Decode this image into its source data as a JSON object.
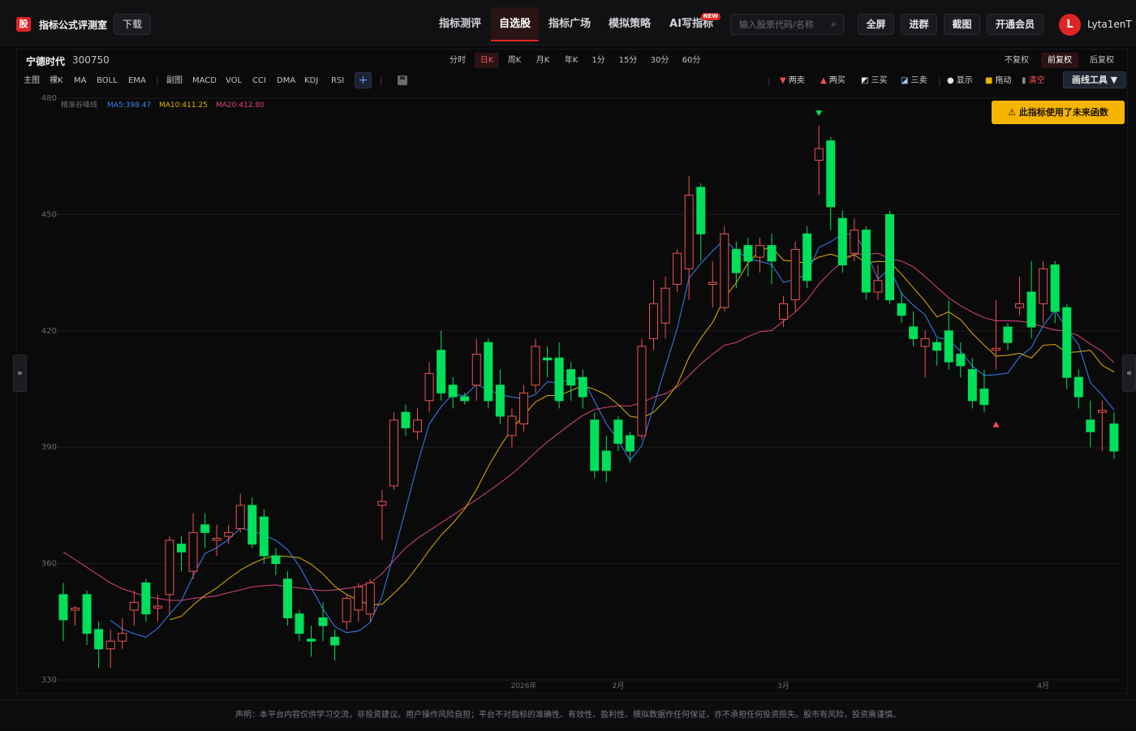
{
  "header": {
    "logo_glyph": "股",
    "app_title": "指标公式评测室",
    "download_label": "下载",
    "nav": [
      {
        "label": "指标测评",
        "active": false,
        "badge": ""
      },
      {
        "label": "自选股",
        "active": true,
        "badge": ""
      },
      {
        "label": "指标广场",
        "active": false,
        "badge": ""
      },
      {
        "label": "模拟策略",
        "active": false,
        "badge": ""
      },
      {
        "label": "AI写指标",
        "active": false,
        "badge": "NEW"
      }
    ],
    "search_placeholder": "输入股票代码/名称",
    "buttons": [
      "全屏",
      "进群",
      "截图",
      "开通会员"
    ],
    "avatar_letter": "L",
    "username": "Lyta1enT"
  },
  "stock": {
    "name": "宁德时代",
    "code": "300750"
  },
  "periods": [
    "分时",
    "日K",
    "周K",
    "月K",
    "年K",
    "1分",
    "15分",
    "30分",
    "60分"
  ],
  "active_period": "日K",
  "adjust": [
    "不复权",
    "前复权",
    "后复权"
  ],
  "active_adjust": "前复权",
  "indicators_main": [
    "主图",
    "裸K",
    "MA",
    "BOLL",
    "EMA"
  ],
  "indicators_sub": [
    "副图",
    "MACD",
    "VOL",
    "CCI",
    "DMA",
    "KDJ",
    "RSI"
  ],
  "plus_label": "+",
  "tools": [
    {
      "label": "两卖",
      "glyph": "▼",
      "color": "#ff4d4d"
    },
    {
      "label": "两买",
      "glyph": "▲",
      "color": "#ff4d4d"
    },
    {
      "label": "三买",
      "glyph": "◩",
      "color": "#e4e4e7"
    },
    {
      "label": "三卖",
      "glyph": "◪",
      "color": "#9ec5ff"
    },
    {
      "label": "显示",
      "glyph": "●",
      "color": "#e4e4e7"
    },
    {
      "label": "拖动",
      "glyph": "■",
      "color": "#e5b400"
    },
    {
      "label": "清空",
      "glyph": "▮",
      "color": "#ff4d4d"
    }
  ],
  "draw_tools_label": "画线工具 ▼",
  "warning_text": "此指标使用了未来函数",
  "legend": {
    "indicator_name": "精准谷峰线",
    "ma5": "MA5:398.47",
    "ma10": "MA10:411.25",
    "ma20": "MA20:412.80",
    "colors": {
      "ma5": "#3b82f6",
      "ma10": "#e5b400",
      "ma20": "#e0457b"
    }
  },
  "footer": "声明：本平台内容仅供学习交流，非投资建议。用户操作风险自担；平台不对指标的准确性、有效性、盈利性、模拟数据作任何保证，亦不承担任何投资损失。股市有风险，投资需谨慎。",
  "chart_data": {
    "type": "candlestick",
    "y_ticks": [
      330,
      360,
      390,
      420,
      450,
      480
    ],
    "ylim": [
      330,
      480
    ],
    "x_labels": [
      {
        "label": "2026年",
        "index": 39
      },
      {
        "label": "2月",
        "index": 47
      },
      {
        "label": "3月",
        "index": 61
      },
      {
        "label": "4月",
        "index": 83
      }
    ],
    "colors": {
      "up": "#ef5350",
      "down": "#00e05a"
    },
    "candles": [
      [
        352.0,
        345.5,
        355.0,
        340.0
      ],
      [
        348.0,
        348.5,
        349.0,
        344.0
      ],
      [
        352.0,
        342.0,
        353.0,
        339.0
      ],
      [
        343.0,
        338.0,
        345.0,
        333.0
      ],
      [
        338.0,
        340.0,
        343.0,
        333.0
      ],
      [
        340.0,
        342.0,
        346.0,
        338.0
      ],
      [
        348.0,
        350.0,
        353.0,
        344.0
      ],
      [
        355.0,
        347.0,
        356.0,
        345.0
      ],
      [
        348.5,
        349.0,
        352.0,
        345.0
      ],
      [
        352.0,
        366.0,
        367.0,
        347.0
      ],
      [
        365.0,
        363.0,
        367.0,
        358.0
      ],
      [
        358.0,
        368.0,
        373.0,
        356.0
      ],
      [
        370.0,
        368.0,
        373.0,
        364.0
      ],
      [
        366.0,
        366.5,
        370.0,
        362.0
      ],
      [
        367.0,
        368.0,
        370.0,
        365.0
      ],
      [
        369.0,
        375.0,
        378.0,
        368.0
      ],
      [
        375.0,
        365.0,
        377.0,
        364.0
      ],
      [
        372.0,
        362.0,
        374.0,
        360.0
      ],
      [
        362.0,
        360.0,
        364.0,
        357.0
      ],
      [
        356.0,
        346.0,
        358.0,
        344.0
      ],
      [
        347.0,
        342.0,
        348.0,
        340.0
      ],
      [
        340.5,
        340.0,
        344.0,
        336.0
      ],
      [
        346.0,
        344.0,
        350.0,
        340.0
      ],
      [
        341.0,
        339.0,
        343.0,
        335.0
      ],
      [
        345.0,
        351.0,
        352.0,
        343.0
      ],
      [
        348.0,
        354.0,
        355.0,
        345.0
      ],
      [
        347.0,
        355.0,
        356.0,
        345.0
      ],
      [
        375.0,
        376.0,
        379.0,
        366.0
      ],
      [
        380.0,
        397.0,
        399.0,
        379.0
      ],
      [
        399.0,
        395.0,
        401.0,
        393.0
      ],
      [
        394.0,
        397.0,
        400.0,
        392.0
      ],
      [
        402.0,
        409.0,
        412.0,
        399.0
      ],
      [
        415.0,
        404.0,
        420.0,
        402.0
      ],
      [
        406.0,
        403.0,
        408.0,
        400.0
      ],
      [
        403.0,
        402.0,
        404.0,
        401.0
      ],
      [
        406.0,
        414.0,
        418.0,
        402.0
      ],
      [
        417.0,
        402.0,
        418.0,
        400.0
      ],
      [
        406.0,
        398.0,
        410.0,
        396.0
      ],
      [
        393.0,
        398.0,
        400.0,
        390.0
      ],
      [
        396.0,
        404.0,
        406.0,
        394.0
      ],
      [
        406.0,
        416.0,
        418.0,
        404.0
      ],
      [
        413.0,
        412.5,
        416.0,
        408.0
      ],
      [
        413.0,
        402.0,
        417.0,
        400.0
      ],
      [
        410.0,
        406.0,
        412.0,
        402.0
      ],
      [
        408.0,
        403.0,
        410.0,
        400.0
      ],
      [
        397.0,
        384.0,
        399.0,
        382.0
      ],
      [
        389.0,
        384.0,
        393.0,
        381.0
      ],
      [
        397.0,
        391.0,
        398.0,
        389.0
      ],
      [
        393.0,
        389.0,
        394.0,
        386.0
      ],
      [
        393.0,
        416.0,
        418.0,
        392.0
      ],
      [
        418.0,
        427.0,
        433.0,
        415.0
      ],
      [
        422.0,
        431.0,
        434.0,
        418.0
      ],
      [
        432.0,
        440.0,
        441.0,
        430.0
      ],
      [
        436.0,
        455.0,
        460.0,
        428.0
      ],
      [
        457.0,
        445.0,
        458.0,
        438.0
      ],
      [
        432.0,
        432.5,
        438.0,
        426.0
      ],
      [
        426.0,
        445.0,
        447.0,
        425.0
      ],
      [
        441.0,
        435.0,
        443.0,
        431.0
      ],
      [
        442.0,
        438.0,
        444.0,
        434.0
      ],
      [
        439.0,
        442.0,
        444.0,
        435.0
      ],
      [
        442.0,
        438.0,
        445.0,
        432.0
      ],
      [
        423.0,
        427.0,
        429.0,
        421.0
      ],
      [
        428.0,
        441.0,
        443.0,
        425.0
      ],
      [
        445.0,
        433.0,
        447.0,
        431.0
      ],
      [
        464.0,
        467.0,
        473.0,
        455.0
      ],
      [
        469.0,
        452.0,
        470.0,
        446.0
      ],
      [
        449.0,
        437.0,
        451.0,
        435.0
      ],
      [
        440.0,
        446.0,
        449.0,
        438.0
      ],
      [
        446.0,
        430.0,
        447.0,
        428.0
      ],
      [
        430.0,
        433.0,
        437.0,
        428.0
      ],
      [
        450.0,
        428.0,
        451.0,
        427.0
      ],
      [
        427.0,
        424.0,
        430.0,
        422.0
      ],
      [
        421.0,
        418.0,
        425.0,
        416.0
      ],
      [
        416.0,
        418.0,
        420.0,
        408.0
      ],
      [
        417.0,
        415.0,
        418.0,
        411.0
      ],
      [
        420.0,
        412.0,
        428.0,
        410.0
      ],
      [
        414.0,
        411.0,
        417.0,
        408.0
      ],
      [
        410.0,
        402.0,
        413.0,
        400.0
      ],
      [
        405.0,
        401.0,
        410.0,
        399.0
      ],
      [
        415.0,
        415.5,
        428.0,
        410.0
      ],
      [
        421.0,
        417.0,
        422.0,
        415.0
      ],
      [
        426.0,
        427.0,
        434.0,
        424.0
      ],
      [
        430.0,
        421.0,
        438.0,
        418.0
      ],
      [
        427.0,
        436.0,
        438.0,
        422.0
      ],
      [
        437.0,
        425.0,
        438.0,
        422.0
      ],
      [
        426.0,
        408.0,
        427.0,
        405.0
      ],
      [
        408.0,
        403.0,
        410.0,
        400.0
      ],
      [
        397.0,
        394.0,
        402.0,
        390.0
      ],
      [
        399.0,
        399.5,
        402.0,
        389.0
      ],
      [
        396.0,
        389.0,
        399.0,
        387.0
      ]
    ],
    "ma5": [
      null,
      null,
      null,
      null,
      345.4,
      343.1,
      341.9,
      341.0,
      343.3,
      346.9,
      350.4,
      356.8,
      362.6,
      364.1,
      366.2,
      369.1,
      368.5,
      367.3,
      366.0,
      363.6,
      359.3,
      353.7,
      348.3,
      343.7,
      342.2,
      342.6,
      344.8,
      351.6,
      362.6,
      374.0,
      385.6,
      396.0,
      400.4,
      403.8,
      403.2,
      406.2,
      404.8,
      403.6,
      402.9,
      402.5,
      403.6,
      406.9,
      406.5,
      407.7,
      407.8,
      401.8,
      396.0,
      391.8,
      386.6,
      390.4,
      400.5,
      410.7,
      420.6,
      433.6,
      437.4,
      440.6,
      443.5,
      440.7,
      438.6,
      437.9,
      437.1,
      432.5,
      433.3,
      434.6,
      441.5,
      443.0,
      445.0,
      445.0,
      440.5,
      433.3,
      436.1,
      429.6,
      426.6,
      424.1,
      418.3,
      417.7,
      414.7,
      410.9,
      408.5,
      408.7,
      409.1,
      413.3,
      415.7,
      421.4,
      425.3,
      420.5,
      416.4,
      406.6,
      403.4,
      399.6
    ],
    "ma10": [
      null,
      null,
      null,
      null,
      null,
      null,
      null,
      null,
      null,
      345.5,
      346.4,
      349.3,
      351.8,
      353.7,
      356.1,
      358.3,
      360.0,
      361.3,
      362.0,
      361.8,
      361.5,
      359.8,
      357.3,
      354.1,
      352.0,
      350.5,
      349.3,
      349.5,
      352.3,
      355.3,
      359.2,
      363.5,
      367.3,
      370.4,
      374.1,
      379.1,
      385.0,
      390.2,
      394.7,
      398.2,
      401.7,
      403.3,
      403.3,
      404.6,
      405.9,
      404.9,
      403.5,
      401.0,
      398.0,
      397.5,
      399.0,
      402.1,
      406.1,
      413.2,
      418.1,
      422.2,
      428.5,
      432.4,
      437.5,
      440.7,
      441.6,
      438.2,
      437.9,
      437.4,
      439.0,
      439.8,
      438.8,
      439.6,
      437.5,
      437.9,
      437.8,
      434.6,
      431.1,
      427.6,
      423.6,
      424.9,
      422.9,
      419.3,
      416.3,
      413.5,
      413.7,
      414.2,
      413.0,
      416.3,
      416.5,
      414.4,
      414.6,
      415.0,
      411.1,
      409.4
    ],
    "ma20": [
      363.0,
      361.0,
      359.0,
      357.0,
      355.0,
      353.5,
      352.5,
      351.5,
      351.0,
      350.5,
      350.5,
      351.0,
      351.3,
      351.7,
      352.5,
      353.2,
      354.0,
      354.3,
      354.5,
      354.0,
      353.7,
      353.3,
      353.0,
      353.2,
      353.6,
      354.0,
      355.0,
      357.4,
      360.8,
      364.0,
      366.5,
      368.5,
      370.5,
      372.5,
      374.5,
      376.5,
      378.6,
      380.8,
      383.1,
      385.8,
      388.7,
      391.4,
      393.7,
      396.0,
      398.2,
      399.7,
      400.3,
      400.7,
      400.6,
      401.5,
      402.9,
      403.8,
      405.5,
      408.5,
      411.5,
      414.0,
      416.3,
      417.0,
      418.5,
      419.8,
      420.1,
      422.5,
      424.8,
      428.0,
      432.0,
      435.2,
      437.8,
      439.8,
      439.8,
      440.0,
      438.6,
      438.0,
      436.5,
      434.0,
      431.2,
      428.5,
      426.5,
      424.8,
      423.4,
      422.6,
      422.6,
      422.5,
      422.0,
      421.0,
      420.2,
      419.9,
      418.7,
      416.6,
      414.7,
      411.8
    ],
    "signals": [
      {
        "index": 64,
        "type": "sell",
        "price": 476.0
      },
      {
        "index": 79,
        "type": "buy",
        "price": 396.0
      }
    ]
  }
}
